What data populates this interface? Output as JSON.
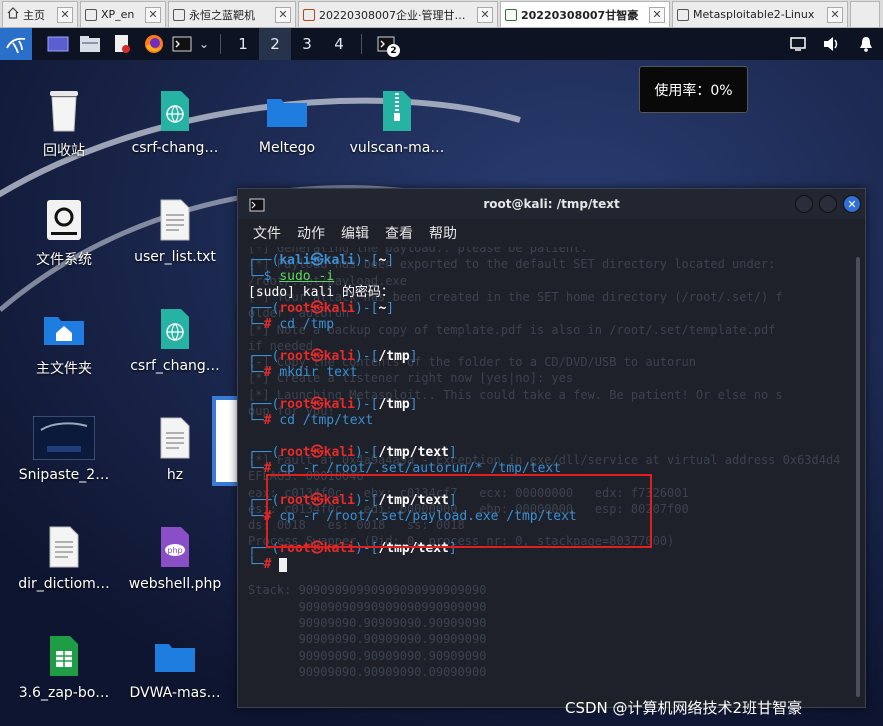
{
  "browser_tabs": [
    {
      "label": "主页",
      "active": false
    },
    {
      "label": "XP_en",
      "active": false
    },
    {
      "label": "永恒之蓝靶机",
      "active": false
    },
    {
      "label": "20220308007企业·管理甘智豪",
      "active": false
    },
    {
      "label": "20220308007甘智豪",
      "active": true
    },
    {
      "label": "Metasploitable2-Linux",
      "active": false
    }
  ],
  "panel": {
    "workspaces": [
      "1",
      "2",
      "3",
      "4"
    ],
    "active_workspace": "2",
    "terminal_badge": "2",
    "icons": [
      "kali-menu-icon",
      "show-desktop-icon",
      "file-manager-icon",
      "text-editor-icon",
      "firefox-icon",
      "terminal-icon",
      "chevron-down-icon",
      "terminal-window-icon",
      "display-icon",
      "volume-icon",
      "notifications-icon"
    ]
  },
  "usage": {
    "text": "使用率：0%"
  },
  "desktop_icons": [
    {
      "label": "回收站",
      "icon": "trash-icon"
    },
    {
      "label": "csrf-chang…",
      "icon": "html-file-icon"
    },
    {
      "label": "Meltego",
      "icon": "folder-icon"
    },
    {
      "label": "vulscan-ma…",
      "icon": "zip-file-icon"
    },
    {
      "label": "文件系统",
      "icon": "drive-icon"
    },
    {
      "label": "user_list.txt",
      "icon": "text-file-icon"
    },
    {
      "label": "主文件夹",
      "icon": "home-folder-icon"
    },
    {
      "label": "csrf_chang…",
      "icon": "html-file-icon"
    },
    {
      "label": "Snipaste_2…",
      "icon": "image-file-icon"
    },
    {
      "label": "hz",
      "icon": "text-file-icon"
    },
    {
      "label": "dir_dictiom…",
      "icon": "text-file-icon"
    },
    {
      "label": "webshell.php",
      "icon": "php-file-icon"
    },
    {
      "label": "3.6_zap-bo…",
      "icon": "spreadsheet-icon"
    },
    {
      "label": "DVWA-mas…",
      "icon": "folder-icon"
    }
  ],
  "terminal": {
    "title": "root@kali: /tmp/text",
    "menu": [
      "文件",
      "动作",
      "编辑",
      "查看",
      "帮助"
    ],
    "user_prompt_user": "kali",
    "prompt_host": "kali",
    "root_user": "root",
    "lines": [
      {
        "user": "kali",
        "path": "~",
        "cmd": "sudo -i",
        "cmd_rest": ""
      },
      {
        "text": "[sudo] kali 的密码："
      },
      {
        "user": "root",
        "path": "~",
        "cmd": "cd /tmp",
        "cmd_rest": ""
      },
      {
        "user": "root",
        "path": "/tmp",
        "cmd": "mkdir text",
        "cmd_rest": ""
      },
      {
        "user": "root",
        "path": "/tmp",
        "cmd": "cd /tmp/text",
        "cmd_rest": ""
      },
      {
        "user": "root",
        "path": "/tmp/text",
        "cmd": "cp -r /root/.set/autorun/* /tmp/text",
        "cmd_rest": ""
      },
      {
        "user": "root",
        "path": "/tmp/text",
        "cmd": "cp -r /root/.set/payload.exe /tmp/text",
        "cmd_rest": ""
      },
      {
        "user": "root",
        "path": "/tmp/text",
        "cmd": "",
        "cmd_rest": ""
      }
    ],
    "ghost": [
      "[*] Generating the payload.. please be patient.",
      "[*] Payload has been exported to the default SET directory located under:",
      "/root/.set/payload.exe",
      "[*] Your attack has been created in the SET home directory (/root/.set/) f",
      "older 'autorun'",
      "[*] Note a backup copy of template.pdf is also in /root/.set/template.pdf",
      "if needed.",
      "[-] Copy the contents of the folder to a CD/DVD/USB to autorun",
      "[*] Create a listener right now [yes|no]: yes",
      "[*] Launching Metasploit.. This could take a few. Be patient! Or else no s",
      "oup for you!",
      "",
      "",
      "[*] Fault at 0x4a9a4a9a - Exception in exe/dll/service at virtual address 0x63d4d4",
      "EFLAGS: 00010046",
      "eax: c0134f0c   ebx: c0134cf7   ecx: 00000000   edx: f7326001",
      "esi: c0134f0c   edi: 00000000   ebp: 00000000   esp: 80207f00",
      "ds: 0018   es: 0018   ss: 0018",
      "Process Swapper (Pid: 0, process nr: 0, stackpage=80377000)",
      "",
      "",
      "Stack: 90909090990909090990909090",
      "       90909090990909090990909090",
      "       90909090.90909090.90909090",
      "       90909090.90909090.90909090",
      "       90909090.90909090.90909090",
      "       90909090.90909090.09090900"
    ]
  },
  "watermark": {
    "text": "CSDN @计算机网络技术2班甘智豪"
  },
  "colors": {
    "kali_blue": "#3d8fd1",
    "root_red": "#e52b2b",
    "highlight_red": "#e0201f",
    "terminal_bg": "#1e212a",
    "panel_bg": "#0d1322"
  }
}
